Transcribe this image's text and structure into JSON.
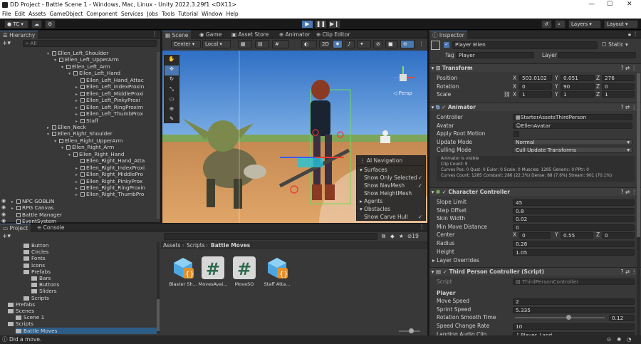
{
  "window": {
    "title": "DD Project - Battle Scene 1 - Windows, Mac, Linux - Unity 2022.3.29f1 <DX11>"
  },
  "menu": [
    "File",
    "Edit",
    "Assets",
    "GameObject",
    "Component",
    "Services",
    "Jobs",
    "Tools",
    "Tutorial",
    "Window",
    "Help"
  ],
  "toolbar": {
    "account": "TC",
    "layers": "Layers",
    "layout": "Layout"
  },
  "hierarchy": {
    "tab": "Hierarchy",
    "search_placeholder": "All",
    "items": [
      {
        "label": "Ellen_Left_Shoulder",
        "depth": 6,
        "arrow": "▾"
      },
      {
        "label": "Ellen_Left_UpperArm",
        "depth": 7,
        "arrow": "▾"
      },
      {
        "label": "Ellen_Left_Arm",
        "depth": 8,
        "arrow": "▾"
      },
      {
        "label": "Ellen_Left_Hand",
        "depth": 9,
        "arrow": "▾"
      },
      {
        "label": "Ellen_Left_Hand_Attac",
        "depth": 10,
        "arrow": ""
      },
      {
        "label": "Ellen_Left_IndexProxin",
        "depth": 10,
        "arrow": "▸"
      },
      {
        "label": "Ellen_Left_MiddleProxi",
        "depth": 10,
        "arrow": "▸"
      },
      {
        "label": "Ellen_Left_PinkyProxi",
        "depth": 10,
        "arrow": "▸"
      },
      {
        "label": "Ellen_Left_RingProxim",
        "depth": 10,
        "arrow": "▸"
      },
      {
        "label": "Ellen_Left_ThumbProx",
        "depth": 10,
        "arrow": "▸"
      },
      {
        "label": "Staff",
        "depth": 10,
        "arrow": "▸"
      },
      {
        "label": "Ellen_Neck",
        "depth": 6,
        "arrow": "▸"
      },
      {
        "label": "Ellen_Right_Shoulder",
        "depth": 6,
        "arrow": "▾"
      },
      {
        "label": "Ellen_Right_UpperArm",
        "depth": 7,
        "arrow": "▾"
      },
      {
        "label": "Ellen_Right_Arm",
        "depth": 8,
        "arrow": "▾"
      },
      {
        "label": "Ellen_Right_Hand",
        "depth": 9,
        "arrow": "▾"
      },
      {
        "label": "Ellen_Right_Hand_Atta",
        "depth": 10,
        "arrow": ""
      },
      {
        "label": "Ellen_Right_IndexProxi",
        "depth": 10,
        "arrow": "▸"
      },
      {
        "label": "Ellen_Right_MiddlePro",
        "depth": 10,
        "arrow": "▸"
      },
      {
        "label": "Ellen_Right_PinkyProx",
        "depth": 10,
        "arrow": "▸"
      },
      {
        "label": "Ellen_Right_RingProxin",
        "depth": 10,
        "arrow": "▸"
      },
      {
        "label": "Ellen_Right_ThumbPro",
        "depth": 10,
        "arrow": "▸"
      },
      {
        "label": "NPC GOBLIN",
        "depth": 1,
        "arrow": "▸"
      },
      {
        "label": "RPG Canvas",
        "depth": 1,
        "arrow": "▸"
      },
      {
        "label": "Battle Manager",
        "depth": 1,
        "arrow": ""
      },
      {
        "label": "EventSystem",
        "depth": 1,
        "arrow": ""
      }
    ]
  },
  "scene": {
    "tabs": [
      "Scene",
      "Game",
      "Asset Store",
      "Animator",
      "Clip Editor"
    ],
    "pivot": "Center",
    "space": "Local",
    "mode2d": "2D",
    "persp": "◁ Persp",
    "overlay": {
      "title": "AI Navigation",
      "sections": [
        {
          "label": "Surfaces",
          "items": [
            {
              "label": "Show Only Selected",
              "checked": true
            },
            {
              "label": "Show NavMesh",
              "checked": true
            },
            {
              "label": "Show HeightMesh",
              "checked": false
            }
          ]
        },
        {
          "label": "Agents",
          "items": []
        },
        {
          "label": "Obstacles",
          "items": [
            {
              "label": "Show Carve Hull",
              "checked": true
            }
          ]
        }
      ]
    }
  },
  "project": {
    "tabs": [
      "Project",
      "Console"
    ],
    "badge": "19",
    "tree": [
      {
        "label": "Button",
        "depth": 3
      },
      {
        "label": "Circles",
        "depth": 3
      },
      {
        "label": "Fonts",
        "depth": 3
      },
      {
        "label": "Icons",
        "depth": 3
      },
      {
        "label": "Prefabs",
        "depth": 3
      },
      {
        "label": "Bars",
        "depth": 4
      },
      {
        "label": "Buttons",
        "depth": 4
      },
      {
        "label": "Sliders",
        "depth": 4
      },
      {
        "label": "Scripts",
        "depth": 3
      },
      {
        "label": "Prefabs",
        "depth": 1
      },
      {
        "label": "Scenes",
        "depth": 1
      },
      {
        "label": "Scene 1",
        "depth": 2
      },
      {
        "label": "Scripts",
        "depth": 1
      },
      {
        "label": "Battle Moves",
        "depth": 2
      }
    ],
    "breadcrumb": [
      "Assets",
      "Scripts",
      "Battle Moves"
    ],
    "assets": [
      {
        "label": "Blaster Sh...",
        "kind": "prefab"
      },
      {
        "label": "MovesAvai...",
        "kind": "script"
      },
      {
        "label": "MoveSO",
        "kind": "script"
      },
      {
        "label": "Staff Atta...",
        "kind": "prefab"
      }
    ]
  },
  "inspector": {
    "tab": "Inspector",
    "object": {
      "name": "Player Ellen",
      "static": "Static",
      "tag_label": "Tag",
      "tag": "Player",
      "layer_label": "Layer",
      "layer": ""
    },
    "transform": {
      "title": "Transform",
      "rows": [
        {
          "label": "Position",
          "x": "503.0102",
          "y": "0.051",
          "z": "276"
        },
        {
          "label": "Rotation",
          "x": "0",
          "y": "90",
          "z": "0"
        },
        {
          "label": "Scale",
          "x": "1",
          "y": "1",
          "z": "1"
        }
      ]
    },
    "animator": {
      "title": "Animator",
      "controller_label": "Controller",
      "controller": "StarterAssetsThirdPerson",
      "avatar_label": "Avatar",
      "avatar": "EllenAvatar",
      "root_motion_label": "Apply Root Motion",
      "update_label": "Update Mode",
      "update": "Normal",
      "culling_label": "Culling Mode",
      "culling": "Cull Update Transforms",
      "info": [
        "Animator is visible",
        "Clip Count: 9",
        "Curves Pos: 0 Quat: 0 Euler: 0 Scale: 0 Muscles: 1285 Generic: 0 PPtr: 0",
        "Curves Count: 1285 Constant: 286 (22.3%) Dense: 88 (7.6%) Stream: 901 (70.1%)"
      ]
    },
    "cc": {
      "title": "Character Controller",
      "rows": [
        {
          "label": "Slope Limit",
          "value": "45"
        },
        {
          "label": "Step Offset",
          "value": "0.8"
        },
        {
          "label": "Skin Width",
          "value": "0.02"
        },
        {
          "label": "Min Move Distance",
          "value": "0"
        }
      ],
      "center_label": "Center",
      "center": {
        "x": "0",
        "y": "0.55",
        "z": "0"
      },
      "radius_label": "Radius",
      "radius": "0.28",
      "height_label": "Height",
      "height": "1.05",
      "overrides": "Layer Overrides"
    },
    "tpc": {
      "title": "Third Person Controller (Script)",
      "script_label": "Script",
      "script": "ThirdPersonController",
      "section": "Player",
      "move_label": "Move Speed",
      "move": "2",
      "sprint_label": "Sprint Speed",
      "sprint": "5.335",
      "rot_label": "Rotation Smooth Time",
      "rot": "0.12",
      "rot_fraction": 0.6,
      "speed_label": "Speed Change Rate",
      "speed": "10",
      "landing_label": "Landing Audio Clip",
      "landing": "Player_Land"
    }
  },
  "status": {
    "message": "Did a move."
  }
}
